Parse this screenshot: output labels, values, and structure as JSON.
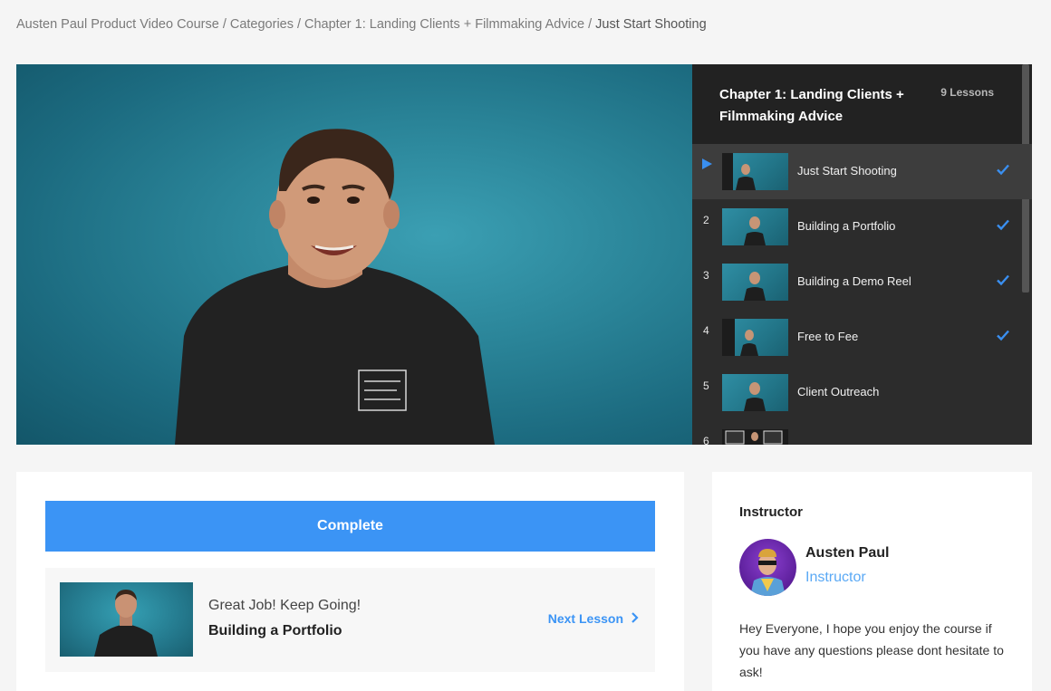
{
  "breadcrumb": {
    "items": [
      "Austen Paul Product Video Course",
      "Categories",
      "Chapter 1: Landing Clients + Filmmaking Advice"
    ],
    "current": "Just Start Shooting",
    "separator": "/"
  },
  "playlist": {
    "chapter_title": "Chapter 1: Landing Clients + Filmmaking Advice",
    "lesson_count": "9 Lessons",
    "lessons": [
      {
        "number": "",
        "title": "Just Start Shooting",
        "completed": true,
        "active": true
      },
      {
        "number": "2",
        "title": "Building a Portfolio",
        "completed": true,
        "active": false
      },
      {
        "number": "3",
        "title": "Building a Demo Reel",
        "completed": true,
        "active": false
      },
      {
        "number": "4",
        "title": "Free to Fee",
        "completed": true,
        "active": false
      },
      {
        "number": "5",
        "title": "Client Outreach",
        "completed": false,
        "active": false
      },
      {
        "number": "6",
        "title": "",
        "completed": false,
        "active": false
      }
    ]
  },
  "lesson_actions": {
    "complete_label": "Complete",
    "next_kicker": "Great Job! Keep Going!",
    "next_title": "Building a Portfolio",
    "next_link_label": "Next Lesson"
  },
  "instructor": {
    "heading": "Instructor",
    "name": "Austen Paul",
    "role": "Instructor",
    "bio": "Hey Everyone, I hope you enjoy the course if you have any questions please dont hesitate to ask!"
  },
  "colors": {
    "accent": "#3b94f5",
    "checkmark": "#3a8ff0",
    "video_bg": "#2a8498",
    "playlist_bg": "#2c2c2c"
  }
}
